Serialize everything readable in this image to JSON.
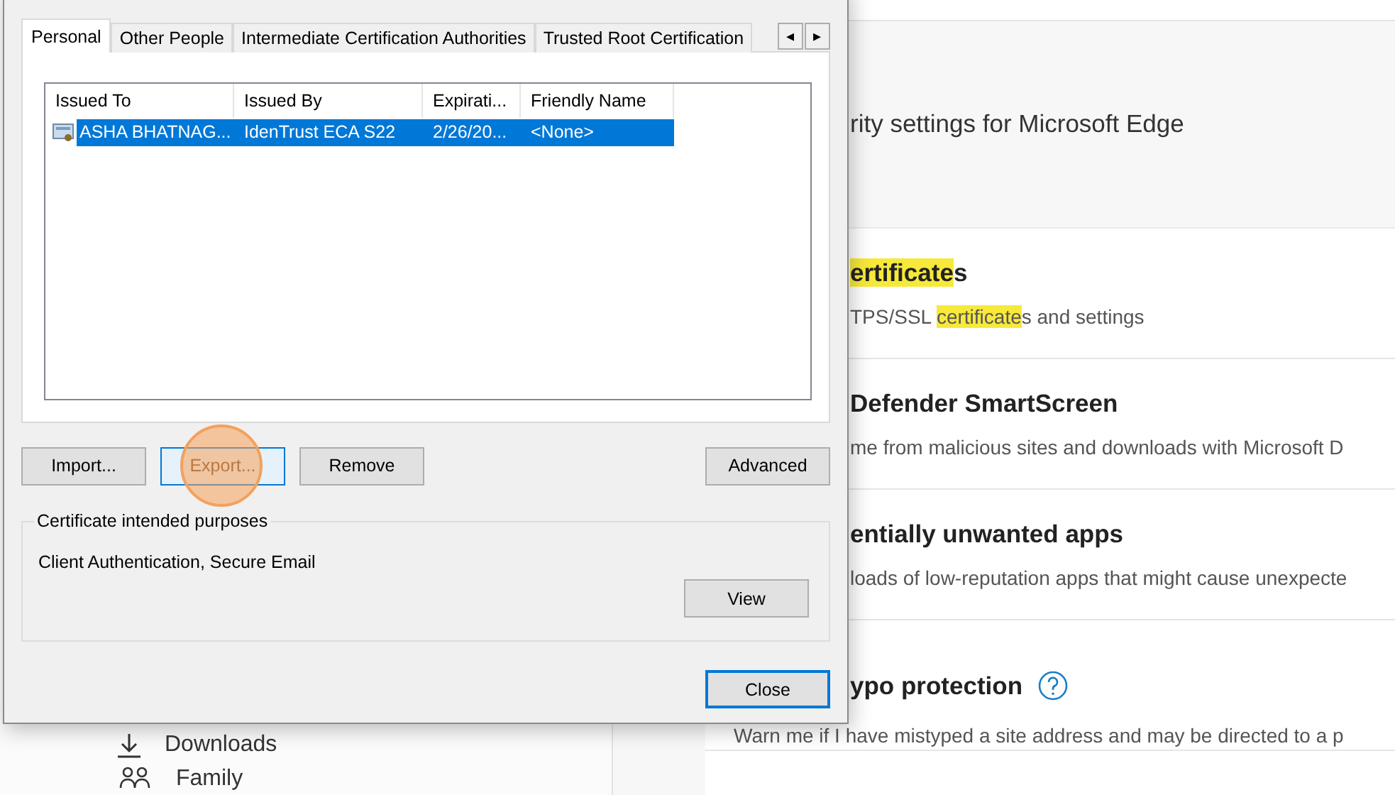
{
  "sidebar": {
    "items": [
      {
        "kind": "downloads",
        "label": "Downloads"
      },
      {
        "kind": "family",
        "label": "Family"
      }
    ]
  },
  "settings": {
    "heading": "rity settings for Microsoft Edge",
    "rows": [
      {
        "title": [
          {
            "text": "ertificate",
            "highlight": true
          },
          {
            "text": "s",
            "highlight": false
          }
        ],
        "description": [
          {
            "text": "TPS/SSL ",
            "highlight": false
          },
          {
            "text": "certificate",
            "highlight": true
          },
          {
            "text": "s and settings",
            "highlight": false
          }
        ],
        "help_icon": false
      },
      {
        "title": [
          {
            "text": "Defender SmartScreen",
            "highlight": false
          }
        ],
        "description": [
          {
            "text": "me from malicious sites and downloads with Microsoft D",
            "highlight": false
          }
        ],
        "help_icon": false
      },
      {
        "title": [
          {
            "text": "entially unwanted apps",
            "highlight": false
          }
        ],
        "description": [
          {
            "text": "loads of low-reputation apps that might cause unexpecte",
            "highlight": false
          }
        ],
        "help_icon": false
      },
      {
        "title": [
          {
            "text": "ypo protection",
            "highlight": false
          }
        ],
        "description": [
          {
            "text": "Warn me if I have mistyped a site address and may be directed to a p",
            "highlight": false
          }
        ],
        "help_icon": true
      }
    ]
  },
  "dialog": {
    "tabs": [
      {
        "label": "Personal",
        "selected": true
      },
      {
        "label": "Other People",
        "selected": false
      },
      {
        "label": "Intermediate Certification Authorities",
        "selected": false
      },
      {
        "label": "Trusted Root Certification",
        "selected": false
      }
    ],
    "tab_scroll": [
      "◂",
      "▸"
    ],
    "list": {
      "columns": [
        "Issued To",
        "Issued By",
        "Expirati...",
        "Friendly Name"
      ],
      "rows": [
        {
          "cells": [
            "ASHA BHATNAG...",
            "IdenTrust ECA S22",
            "2/26/20...",
            "<None>"
          ],
          "selected": true
        }
      ]
    },
    "buttons": [
      {
        "label": "Import...",
        "focused": false
      },
      {
        "label": "Export...",
        "focused": true
      },
      {
        "label": "Remove",
        "focused": false
      }
    ],
    "advanced_button": "Advanced",
    "purposes": {
      "legend": "Certificate intended purposes",
      "text": "Client Authentication, Secure Email",
      "button": "View"
    },
    "close_button": {
      "label": "Close",
      "default": true
    }
  }
}
